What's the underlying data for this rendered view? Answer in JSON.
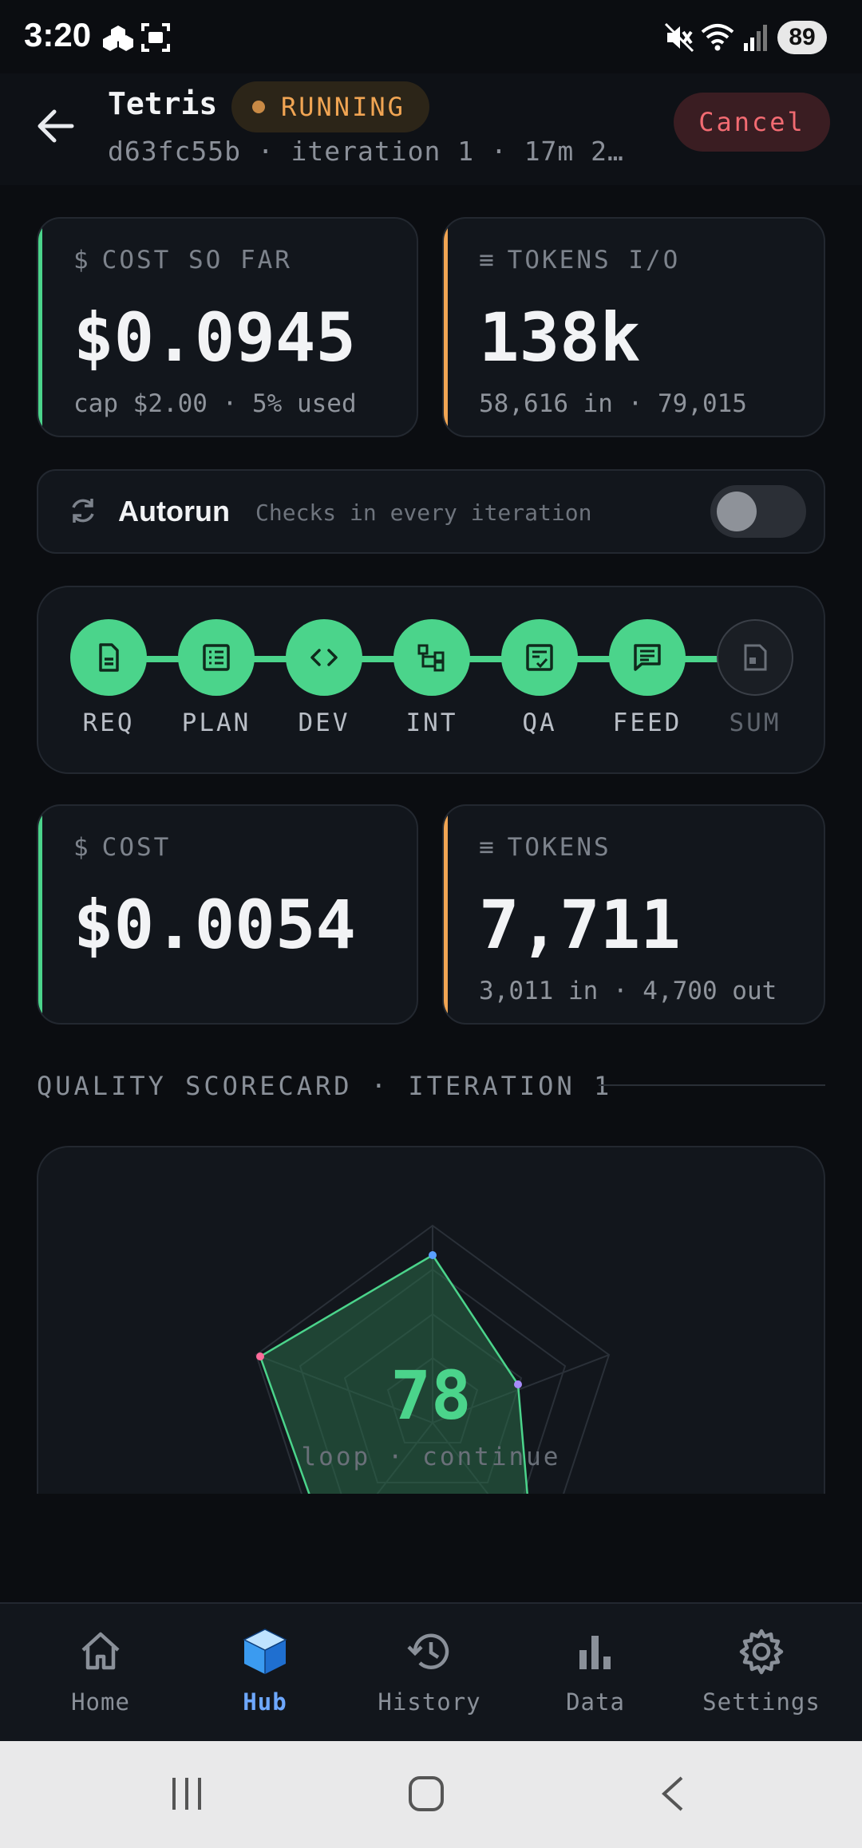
{
  "status_bar": {
    "time": "3:20",
    "battery": "89",
    "icons": [
      "app-cluster-icon",
      "screenshot-icon",
      "mute-icon",
      "wifi-icon",
      "signal-icon"
    ]
  },
  "header": {
    "title": "Tetris",
    "status_badge": "RUNNING",
    "subtitle": "d63fc55b · iteration 1 · 17m 2…",
    "cancel_label": "Cancel"
  },
  "run_totals": {
    "cost": {
      "label": "COST SO FAR",
      "icon": "$",
      "value": "$0.0945",
      "sub": "cap $2.00 · 5% used"
    },
    "tokens": {
      "label": "TOKENS I/O",
      "icon": "≡",
      "value": "138k",
      "sub": "58,616 in · 79,015"
    }
  },
  "autorun": {
    "title": "Autorun",
    "description": "Checks in every iteration",
    "enabled": false
  },
  "pipeline": {
    "stages": [
      {
        "label": "REQ",
        "icon": "document-icon",
        "done": true
      },
      {
        "label": "PLAN",
        "icon": "list-icon",
        "done": true
      },
      {
        "label": "DEV",
        "icon": "code-icon",
        "done": true
      },
      {
        "label": "INT",
        "icon": "integration-icon",
        "done": true
      },
      {
        "label": "QA",
        "icon": "checklist-icon",
        "done": true
      },
      {
        "label": "FEED",
        "icon": "chat-icon",
        "done": true
      },
      {
        "label": "SUM",
        "icon": "summary-icon",
        "done": false
      }
    ]
  },
  "stage_metrics": {
    "cost": {
      "label": "COST",
      "icon": "$",
      "value": "$0.0054"
    },
    "tokens": {
      "label": "TOKENS",
      "icon": "≡",
      "value": "7,711",
      "sub": "3,011 in · 4,700 out"
    }
  },
  "scorecard": {
    "section_title": "QUALITY SCORECARD · ITERATION 1",
    "score": "78",
    "decision": "loop · continue"
  },
  "colors": {
    "accent_green": "#4bd48b",
    "accent_orange": "#f1a553",
    "danger": "#f26b72",
    "nav_active": "#6ea8ff"
  },
  "bottom_nav": {
    "items": [
      {
        "label": "Home",
        "icon": "home-icon",
        "active": false
      },
      {
        "label": "Hub",
        "icon": "cube-icon",
        "active": true
      },
      {
        "label": "History",
        "icon": "history-icon",
        "active": false
      },
      {
        "label": "Data",
        "icon": "bar-chart-icon",
        "active": false
      },
      {
        "label": "Settings",
        "icon": "gear-icon",
        "active": false
      }
    ]
  }
}
